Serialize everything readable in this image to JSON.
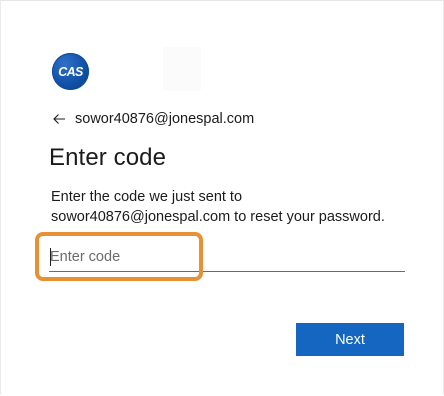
{
  "brand": {
    "logo_text": "CAS",
    "logo_color": "#1252a8"
  },
  "back": {
    "icon": "arrow-left-icon",
    "email": "sowor40876@jonespal.com"
  },
  "page_title": "Enter code",
  "description": {
    "line1": "Enter the code we just sent to",
    "line2": "sowor40876@jonespal.com to reset your password."
  },
  "code_input": {
    "value": "",
    "placeholder": "Enter code"
  },
  "next_button": {
    "label": "Next",
    "color": "#1566c0"
  },
  "highlight_color": "#e79034"
}
